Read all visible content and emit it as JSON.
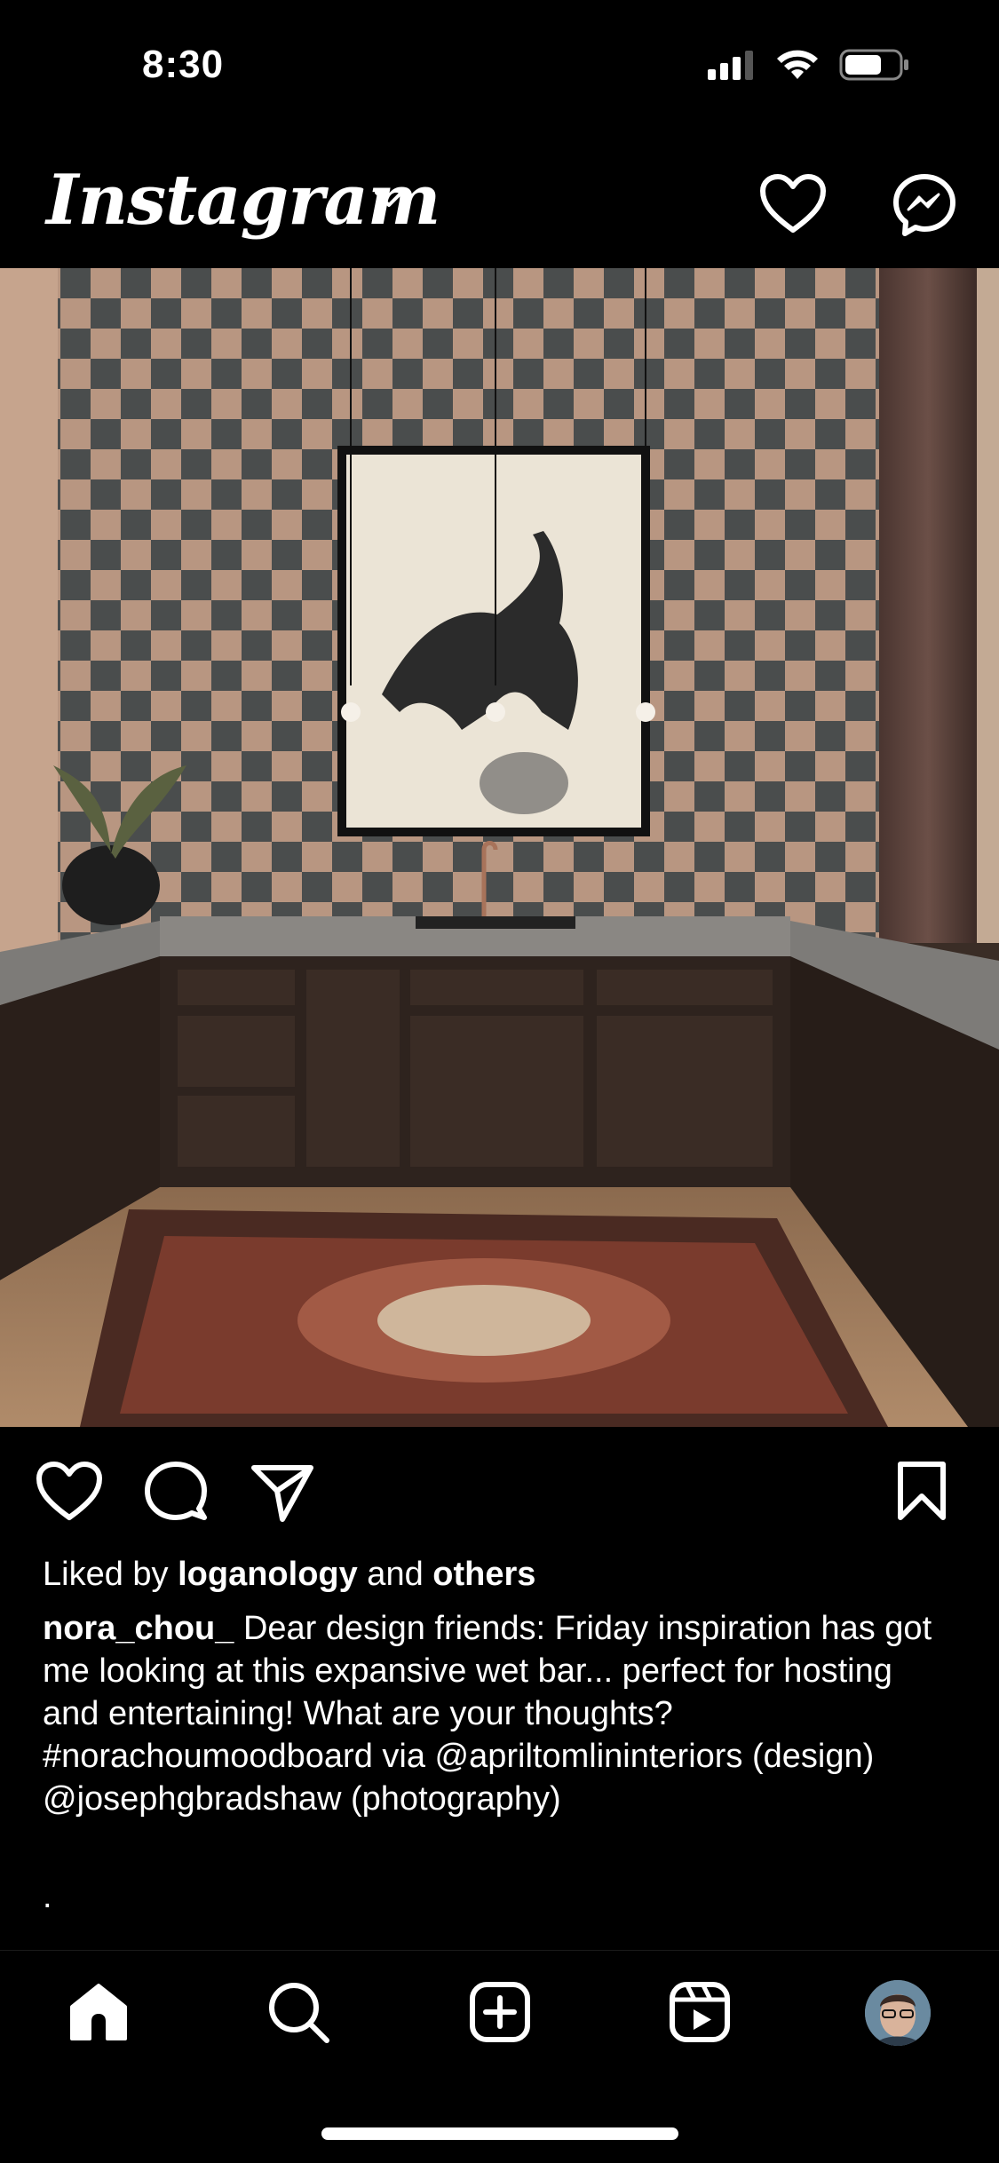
{
  "status_bar": {
    "time": "8:30"
  },
  "header": {
    "app_name": "Instagram"
  },
  "post": {
    "liked_by_prefix": "Liked by ",
    "liked_by_user": "loganology",
    "liked_by_mid": " and ",
    "liked_by_others": "others",
    "author": "nora_chou_",
    "caption": " Dear design friends: Friday inspiration has got me looking at this expansive wet bar... perfect for hosting and entertaining! What are your thoughts? #norachoumoodboard via @apriltomlininteriors (design) @josephgbradshaw (photography)",
    "caption_trail": "."
  },
  "icons": {
    "header": [
      "chevron-down-icon",
      "heart-icon",
      "messenger-icon"
    ],
    "actions": [
      "like-icon",
      "comment-icon",
      "share-icon",
      "bookmark-icon"
    ],
    "nav": [
      "home-icon",
      "search-icon",
      "create-icon",
      "reels-icon",
      "profile-avatar"
    ]
  },
  "colors": {
    "background": "#000000",
    "text": "#ffffff"
  }
}
